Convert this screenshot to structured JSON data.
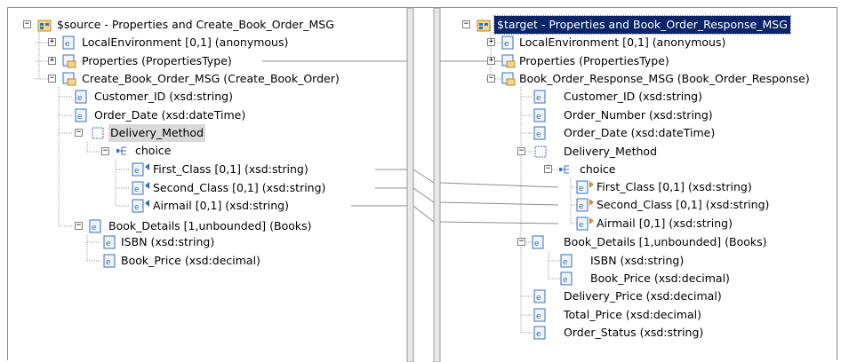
{
  "source": {
    "root_label": "$source - Properties and Create_Book_Order_MSG",
    "items": [
      {
        "label": "LocalEnvironment [0,1] (anonymous)"
      },
      {
        "label": "Properties (PropertiesType)"
      },
      {
        "label": "Create_Book_Order_MSG (Create_Book_Order)"
      },
      {
        "label": "Customer_ID (xsd:string)"
      },
      {
        "label": "Order_Date (xsd:dateTime)"
      },
      {
        "label": "Delivery_Method"
      },
      {
        "label": "choice"
      },
      {
        "label": "First_Class [0,1] (xsd:string)"
      },
      {
        "label": "Second_Class [0,1] (xsd:string)"
      },
      {
        "label": "Airmail [0,1] (xsd:string)"
      },
      {
        "label": "Book_Details [1,unbounded] (Books)"
      },
      {
        "label": "ISBN (xsd:string)"
      },
      {
        "label": "Book_Price (xsd:decimal)"
      }
    ]
  },
  "target": {
    "root_label": "$target - Properties and Book_Order_Response_MSG",
    "items": [
      {
        "label": "LocalEnvironment [0,1] (anonymous)"
      },
      {
        "label": "Properties (PropertiesType)"
      },
      {
        "label": "Book_Order_Response_MSG (Book_Order_Response)"
      },
      {
        "label": "Customer_ID (xsd:string)"
      },
      {
        "label": "Order_Number (xsd:string)"
      },
      {
        "label": "Order_Date (xsd:dateTime)"
      },
      {
        "label": "Delivery_Method"
      },
      {
        "label": "choice"
      },
      {
        "label": "First_Class [0,1] (xsd:string)"
      },
      {
        "label": "Second_Class [0,1] (xsd:string)"
      },
      {
        "label": "Airmail [0,1] (xsd:string)"
      },
      {
        "label": "Book_Details [1,unbounded] (Books)"
      },
      {
        "label": "ISBN (xsd:string)"
      },
      {
        "label": "Book_Price (xsd:decimal)"
      },
      {
        "label": "Delivery_Price (xsd:decimal)"
      },
      {
        "label": "Total_Price (xsd:decimal)"
      },
      {
        "label": "Order_Status (xsd:string)"
      }
    ]
  },
  "colors": {
    "selection": "#0a246a",
    "mapping_line": "#8c8c8c",
    "tree_line": "#a0a0a0",
    "element_icon": "#3f6fb4",
    "message_icon": "#d89a2c",
    "arrow_source": "#2f6fb8",
    "arrow_target": "#d88a30"
  },
  "icons": {
    "root": "message-tree-root-icon",
    "element": "xsd-element-icon",
    "message": "message-element-icon",
    "group": "group-icon",
    "choice": "choice-icon"
  }
}
